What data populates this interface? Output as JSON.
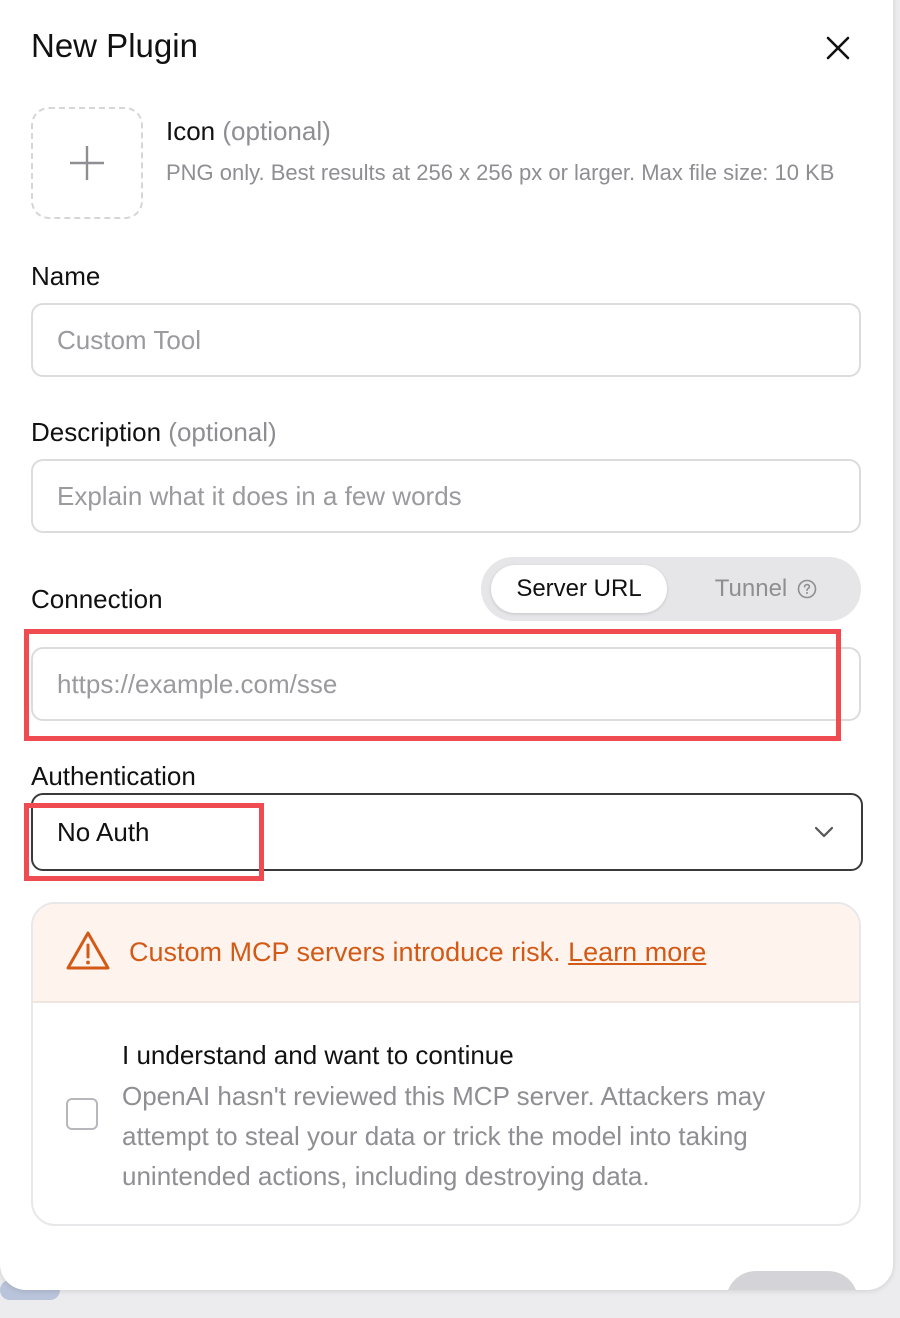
{
  "dialog": {
    "title": "New Plugin"
  },
  "icon_field": {
    "label": "Icon",
    "optional": "(optional)",
    "help": "PNG only. Best results at 256 x 256 px or larger. Max file size: 10 KB"
  },
  "name_field": {
    "label": "Name",
    "placeholder": "Custom Tool",
    "value": ""
  },
  "description_field": {
    "label": "Description",
    "optional": "(optional)",
    "placeholder": "Explain what it does in a few words",
    "value": ""
  },
  "connection": {
    "label": "Connection",
    "modes": [
      {
        "label": "Server URL",
        "selected": true
      },
      {
        "label": "Tunnel",
        "selected": false
      }
    ],
    "url_placeholder": "https://example.com/sse",
    "url_value": ""
  },
  "authentication": {
    "label": "Authentication",
    "selected": "No Auth"
  },
  "warning": {
    "text": "Custom MCP servers introduce risk.",
    "link": "Learn more"
  },
  "acknowledge": {
    "title": "I understand and want to continue",
    "body": "OpenAI hasn't reviewed this MCP server. Attackers may attempt to steal your data or trick the model into taking unintended actions, including destroying data.",
    "checked": false
  },
  "colors": {
    "warning_text": "#d35a16",
    "warning_bg": "#fff3ee",
    "highlight": "#ef4b50"
  }
}
